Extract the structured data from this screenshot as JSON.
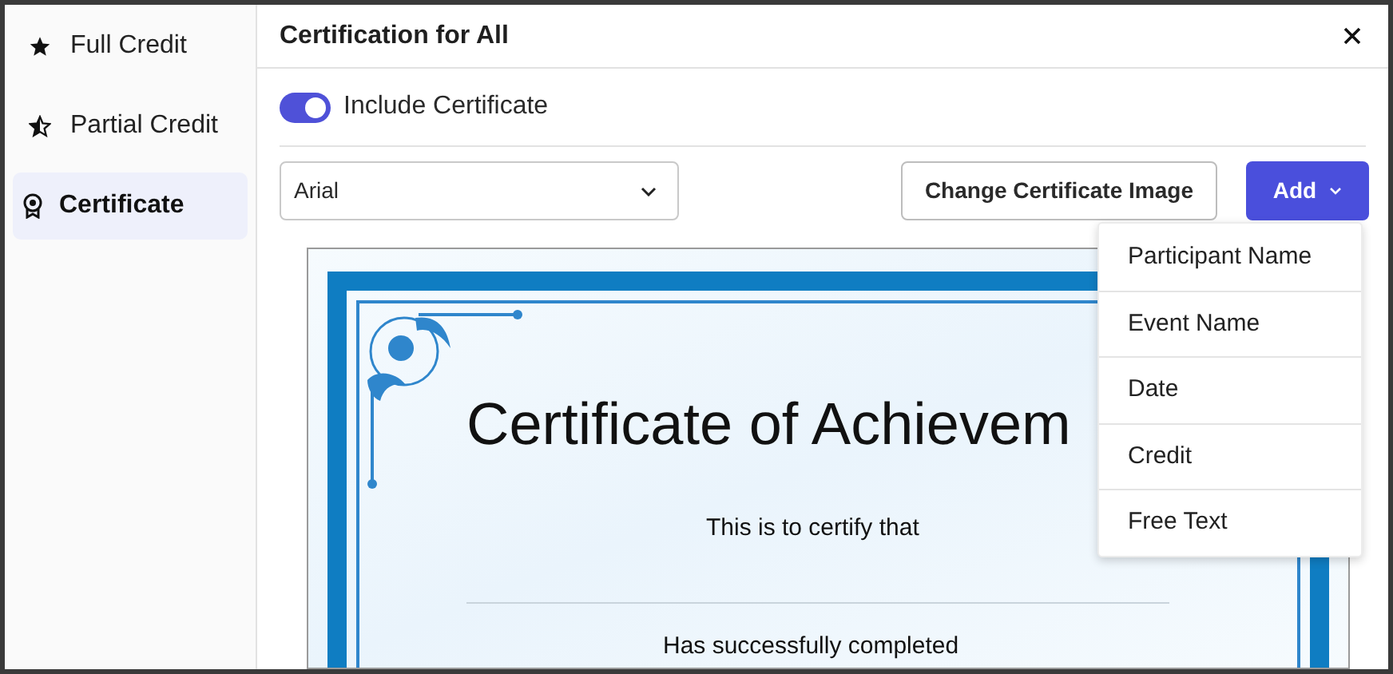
{
  "sidebar": {
    "items": [
      {
        "label": "Full Credit",
        "kind": "star",
        "selected": false
      },
      {
        "label": "Partial Credit",
        "kind": "half-star",
        "selected": false
      },
      {
        "label": "Certificate",
        "kind": "award",
        "selected": true
      }
    ]
  },
  "dialog": {
    "title": "Certification for All"
  },
  "include_certificate": {
    "label": "Include Certificate",
    "on": true
  },
  "font_select": {
    "value": "Arial"
  },
  "change_image_button": "Change Certificate Image",
  "add_button": "Add",
  "add_menu": {
    "items": [
      "Participant Name",
      "Event Name",
      "Date",
      "Credit",
      "Free Text"
    ]
  },
  "certificate": {
    "title": "Certificate of Achievem",
    "intro": "This is to certify that",
    "completed": "Has successfully completed"
  }
}
